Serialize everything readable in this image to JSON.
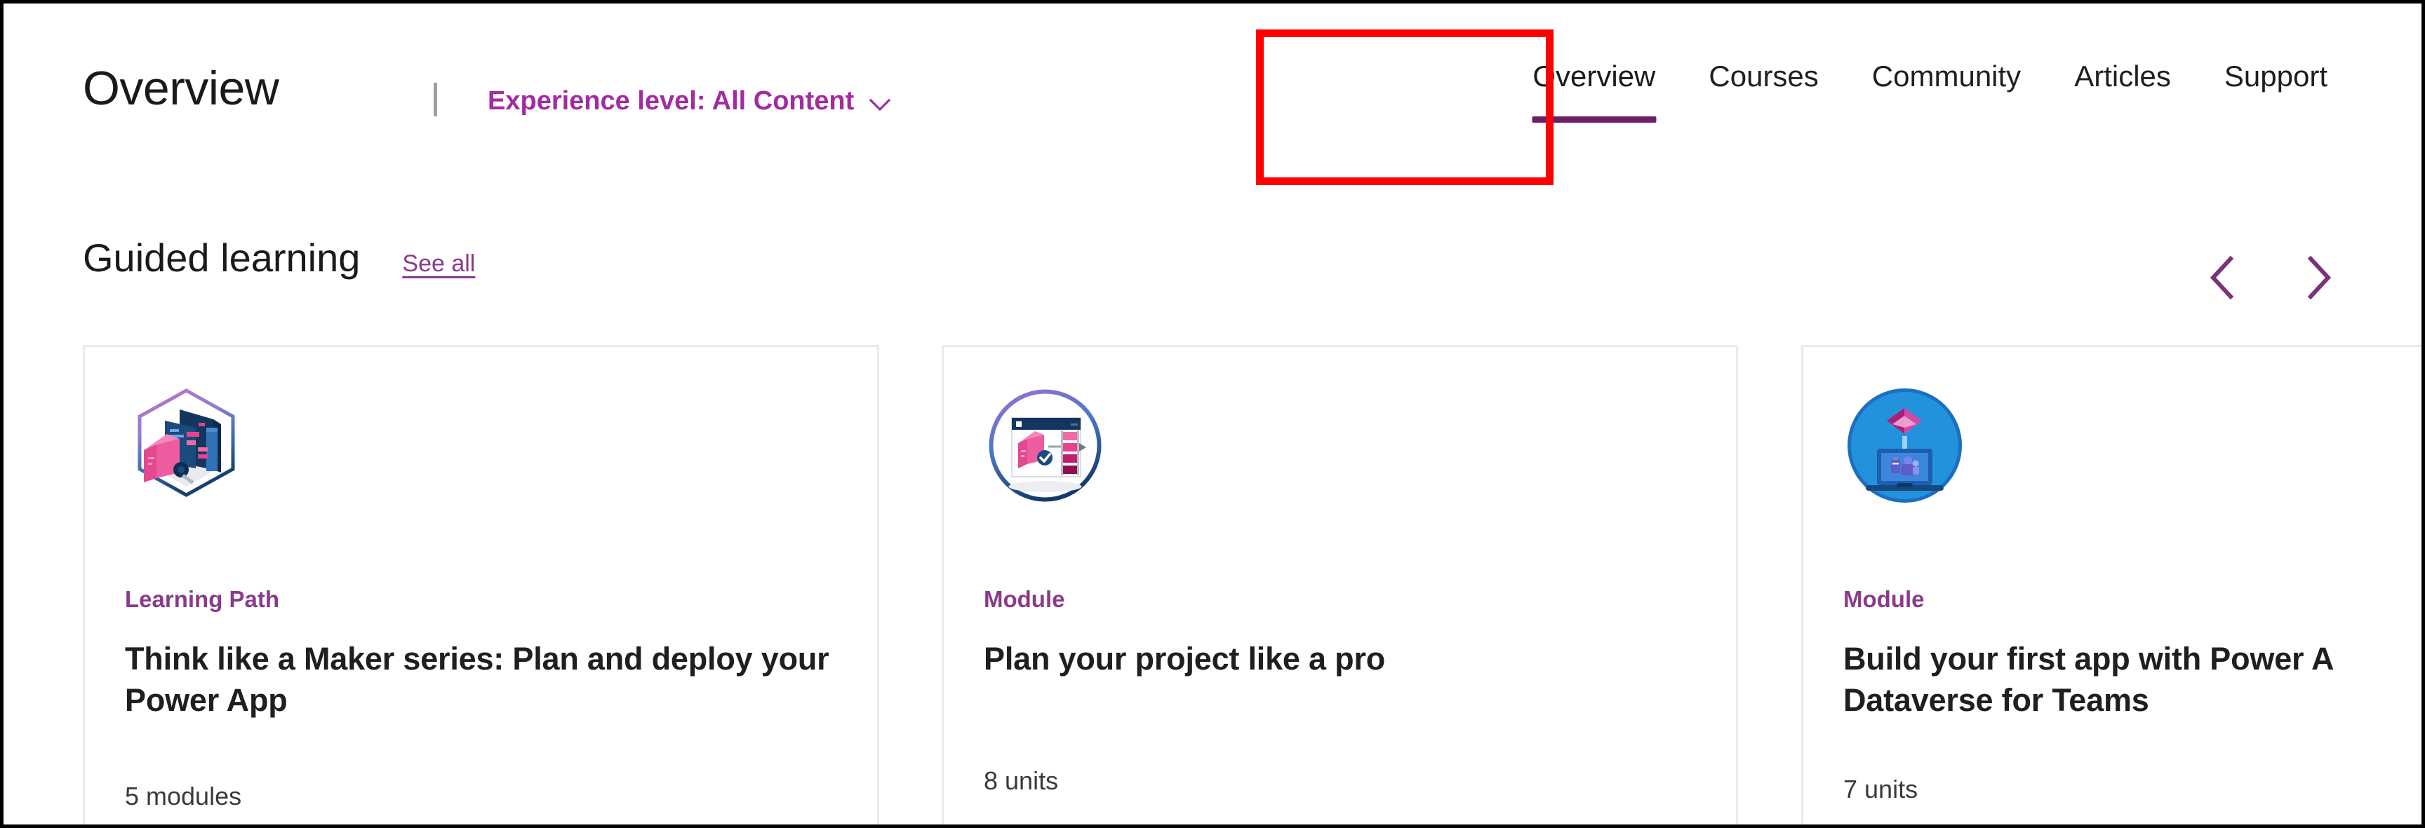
{
  "header": {
    "page_title": "Overview",
    "divider": "|",
    "experience_filter": {
      "label": "Experience level: All Content",
      "chevron_icon": "chevron-down-icon"
    }
  },
  "nav": {
    "tabs": [
      {
        "label": "Overview",
        "active": true
      },
      {
        "label": "Courses",
        "active": false
      },
      {
        "label": "Community",
        "active": false
      },
      {
        "label": "Articles",
        "active": false
      },
      {
        "label": "Support",
        "active": false
      }
    ]
  },
  "annotation": {
    "highlight_color": "#fe0000",
    "target": "Overview"
  },
  "section": {
    "title": "Guided learning",
    "see_all_label": "See all",
    "carousel": {
      "prev_icon": "chevron-left-icon",
      "next_icon": "chevron-right-icon"
    }
  },
  "cards": [
    {
      "icon_name": "hexagon-cube-screens-icon",
      "kicker": "Learning Path",
      "title": "Think like a Maker series: Plan and deploy your Power App",
      "meta": "5 modules"
    },
    {
      "icon_name": "circle-browser-cube-bars-icon",
      "kicker": "Module",
      "title": "Plan your project like a pro",
      "meta": "8 units"
    },
    {
      "icon_name": "circle-powerapps-laptop-teams-icon",
      "kicker": "Module",
      "title_line1": "Build your first app with Power A",
      "title_line2": "Dataverse for Teams",
      "meta": "7 units"
    }
  ],
  "colors": {
    "brand_purple": "#a32ba0",
    "link_purple": "#8a3a8a",
    "tab_underline": "#6b2069",
    "text_primary": "#201f1e",
    "card_border": "#edebe9",
    "annotation_red": "#fe0000"
  }
}
